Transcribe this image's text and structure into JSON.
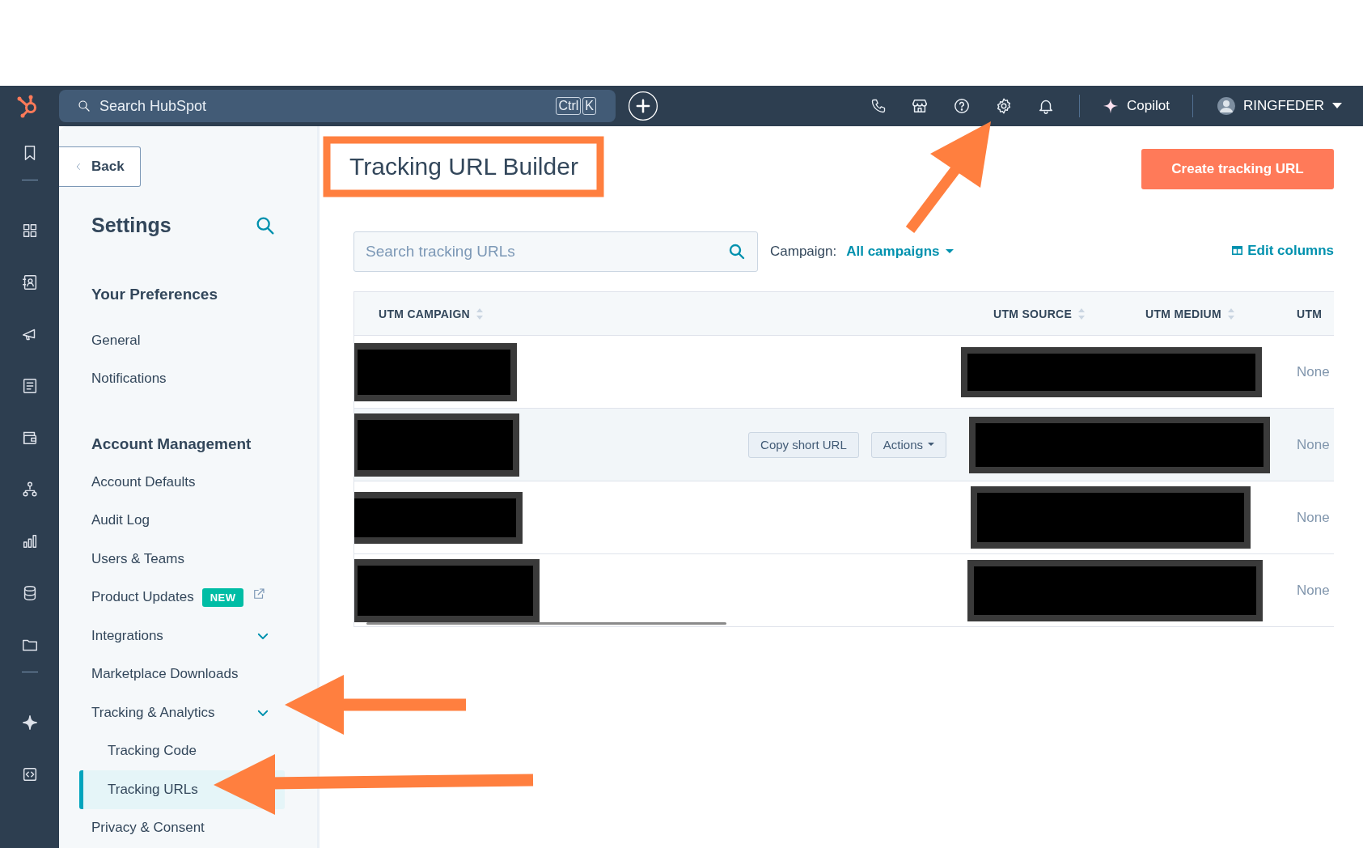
{
  "topbar": {
    "search": {
      "placeholder": "Search HubSpot"
    },
    "shortcut": [
      "Ctrl",
      "K"
    ],
    "copilot": "Copilot",
    "account": "RINGFEDER"
  },
  "sidebar": {
    "back": "Back",
    "title": "Settings",
    "sections": [
      {
        "title": "Your Preferences",
        "items": [
          {
            "label": "General",
            "selected": false
          },
          {
            "label": "Notifications",
            "selected": false
          }
        ]
      },
      {
        "title": "Account Management",
        "items": [
          {
            "label": "Account Defaults",
            "selected": false
          },
          {
            "label": "Audit Log",
            "selected": false
          },
          {
            "label": "Users & Teams",
            "selected": false
          },
          {
            "label": "Product Updates",
            "badge": "NEW",
            "external": true,
            "selected": false
          },
          {
            "label": "Integrations",
            "toggle": true,
            "selected": false
          },
          {
            "label": "Marketplace Downloads",
            "selected": false
          },
          {
            "label": "Tracking & Analytics",
            "toggle": true,
            "selected": false,
            "children": [
              {
                "label": "Tracking Code",
                "selected": false
              },
              {
                "label": "Tracking URLs",
                "selected": true
              }
            ]
          },
          {
            "label": "Privacy & Consent",
            "selected": false
          }
        ]
      }
    ]
  },
  "page": {
    "title": "Tracking URL Builder",
    "create_button": "Create tracking URL",
    "search": {
      "placeholder": "Search tracking URLs"
    },
    "campaign_label": "Campaign:",
    "campaign_value": "All campaigns",
    "edit_columns": "Edit columns"
  },
  "table": {
    "columns": [
      {
        "label": "UTM CAMPAIGN",
        "sortable": true
      },
      {
        "label": "UTM SOURCE",
        "sortable": true
      },
      {
        "label": "UTM MEDIUM",
        "sortable": true
      },
      {
        "label": "UTM",
        "sortable": false
      }
    ],
    "rows": [
      {
        "hovered": false,
        "column_4": "None"
      },
      {
        "hovered": true,
        "buttons": [
          "Copy short URL",
          "Actions"
        ],
        "column_4": "None"
      },
      {
        "hovered": false,
        "column_4": "None"
      },
      {
        "hovered": false,
        "column_4": "None"
      }
    ]
  }
}
